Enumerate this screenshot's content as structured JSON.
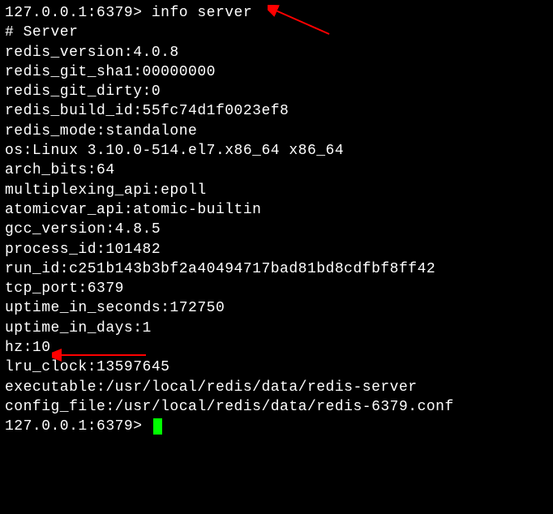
{
  "prompt1": {
    "host": "127.0.0.1:6379>",
    "command": "info server"
  },
  "section_header": "# Server",
  "info": {
    "redis_version": "redis_version:4.0.8",
    "redis_git_sha1": "redis_git_sha1:00000000",
    "redis_git_dirty": "redis_git_dirty:0",
    "redis_build_id": "redis_build_id:55fc74d1f0023ef8",
    "redis_mode": "redis_mode:standalone",
    "os": "os:Linux 3.10.0-514.el7.x86_64 x86_64",
    "arch_bits": "arch_bits:64",
    "multiplexing_api": "multiplexing_api:epoll",
    "atomicvar_api": "atomicvar_api:atomic-builtin",
    "gcc_version": "gcc_version:4.8.5",
    "process_id": "process_id:101482",
    "run_id": "run_id:c251b143b3bf2a40494717bad81bd8cdfbf8ff42",
    "tcp_port": "tcp_port:6379",
    "uptime_in_seconds": "uptime_in_seconds:172750",
    "uptime_in_days": "uptime_in_days:1",
    "hz": "hz:10",
    "lru_clock": "lru_clock:13597645",
    "executable": "executable:/usr/local/redis/data/redis-server",
    "config_file": "config_file:/usr/local/redis/data/redis-6379.conf"
  },
  "prompt2": {
    "host": "127.0.0.1:6379>"
  },
  "annotations": {
    "arrow1_color": "#ff0000",
    "arrow2_color": "#ff0000"
  }
}
